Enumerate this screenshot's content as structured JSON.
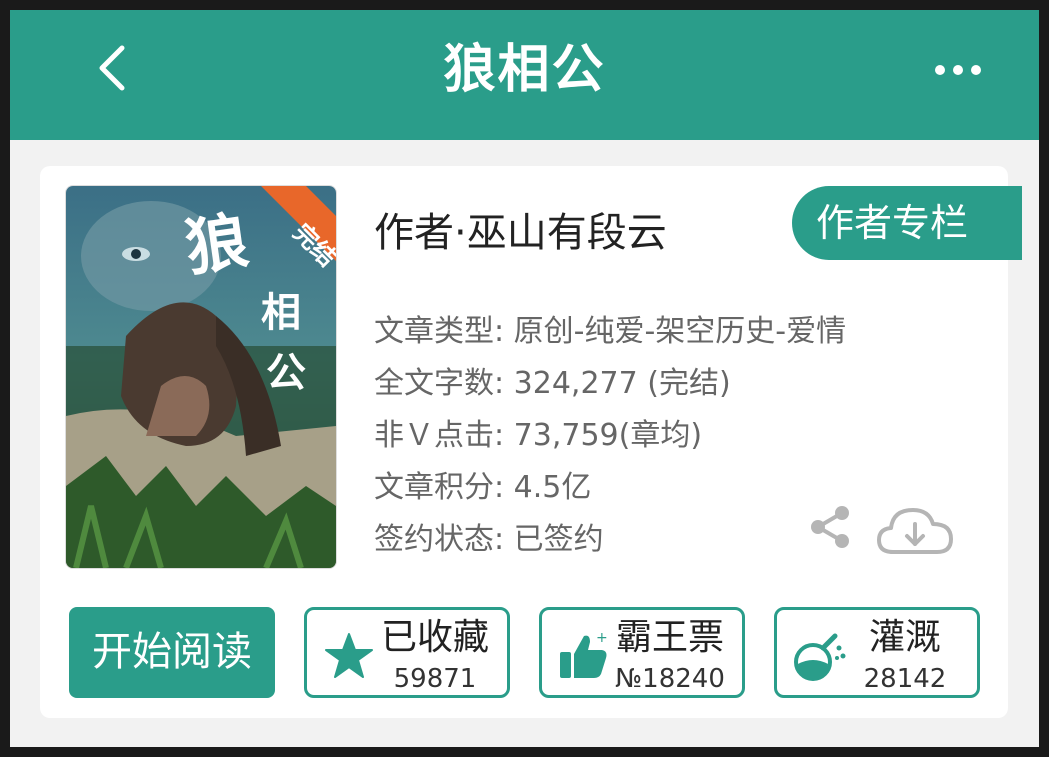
{
  "header": {
    "title": "狼相公",
    "back_icon": "chevron-left-icon",
    "more_icon": "more-horizontal-icon"
  },
  "cover": {
    "title_text": "狼相公",
    "badge": "完结",
    "badge_color": "#e8672a"
  },
  "book": {
    "author_line": "作者·巫山有段云",
    "author_column_label": "作者专栏",
    "meta": [
      {
        "label": "文章类型",
        "value": "原创-纯爱-架空历史-爱情"
      },
      {
        "label": "全文字数",
        "value": "324,277 (完结)"
      },
      {
        "label": "非Ｖ点击",
        "value": "73,759(章均)"
      },
      {
        "label": "文章积分",
        "value": "4.5亿"
      },
      {
        "label": "签约状态",
        "value": "已签约"
      }
    ],
    "share_icon": "share-icon",
    "download_icon": "cloud-download-icon"
  },
  "actions": {
    "read_label": "开始阅读",
    "collect": {
      "label": "已收藏",
      "value": "59871",
      "icon": "star-icon"
    },
    "vote": {
      "label": "霸王票",
      "value": "№18240",
      "icon": "thumbs-up-icon"
    },
    "water": {
      "label": "灌溉",
      "value": "28142",
      "icon": "watering-flask-icon"
    }
  },
  "colors": {
    "accent": "#2a9d8a",
    "background": "#f2f2f2"
  }
}
